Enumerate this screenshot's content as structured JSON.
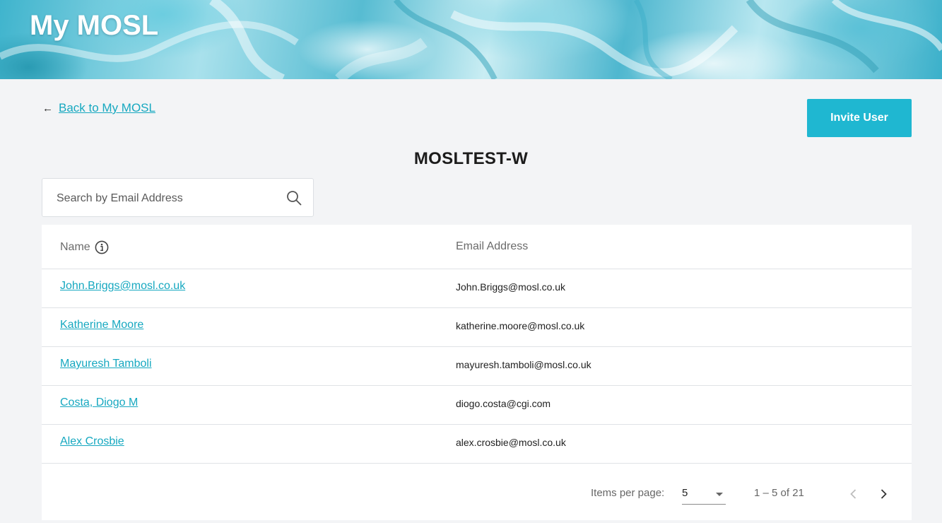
{
  "header": {
    "title": "My MOSL"
  },
  "nav": {
    "back_arrow": "←",
    "back_label": "Back to My MOSL"
  },
  "actions": {
    "invite_label": "Invite User"
  },
  "page": {
    "title": "MOSLTEST-W"
  },
  "search": {
    "placeholder": "Search by Email Address",
    "value": "",
    "icon": "search-icon"
  },
  "table": {
    "columns": {
      "name": "Name",
      "email": "Email Address"
    },
    "name_info_icon": "info-icon",
    "rows": [
      {
        "name": "John.Briggs@mosl.co.uk",
        "email": "John.Briggs@mosl.co.uk"
      },
      {
        "name": "Katherine Moore",
        "email": "katherine.moore@mosl.co.uk"
      },
      {
        "name": "Mayuresh Tamboli",
        "email": "mayuresh.tamboli@mosl.co.uk"
      },
      {
        "name": "Costa, Diogo M",
        "email": "diogo.costa@cgi.com"
      },
      {
        "name": "Alex Crosbie",
        "email": "alex.crosbie@mosl.co.uk"
      }
    ]
  },
  "paginator": {
    "items_per_page_label": "Items per page:",
    "items_per_page_value": "5",
    "range_label": "1 – 5 of 21"
  },
  "colors": {
    "accent": "#1fb7d1",
    "link": "#16a8c0",
    "background": "#f3f4f6"
  }
}
